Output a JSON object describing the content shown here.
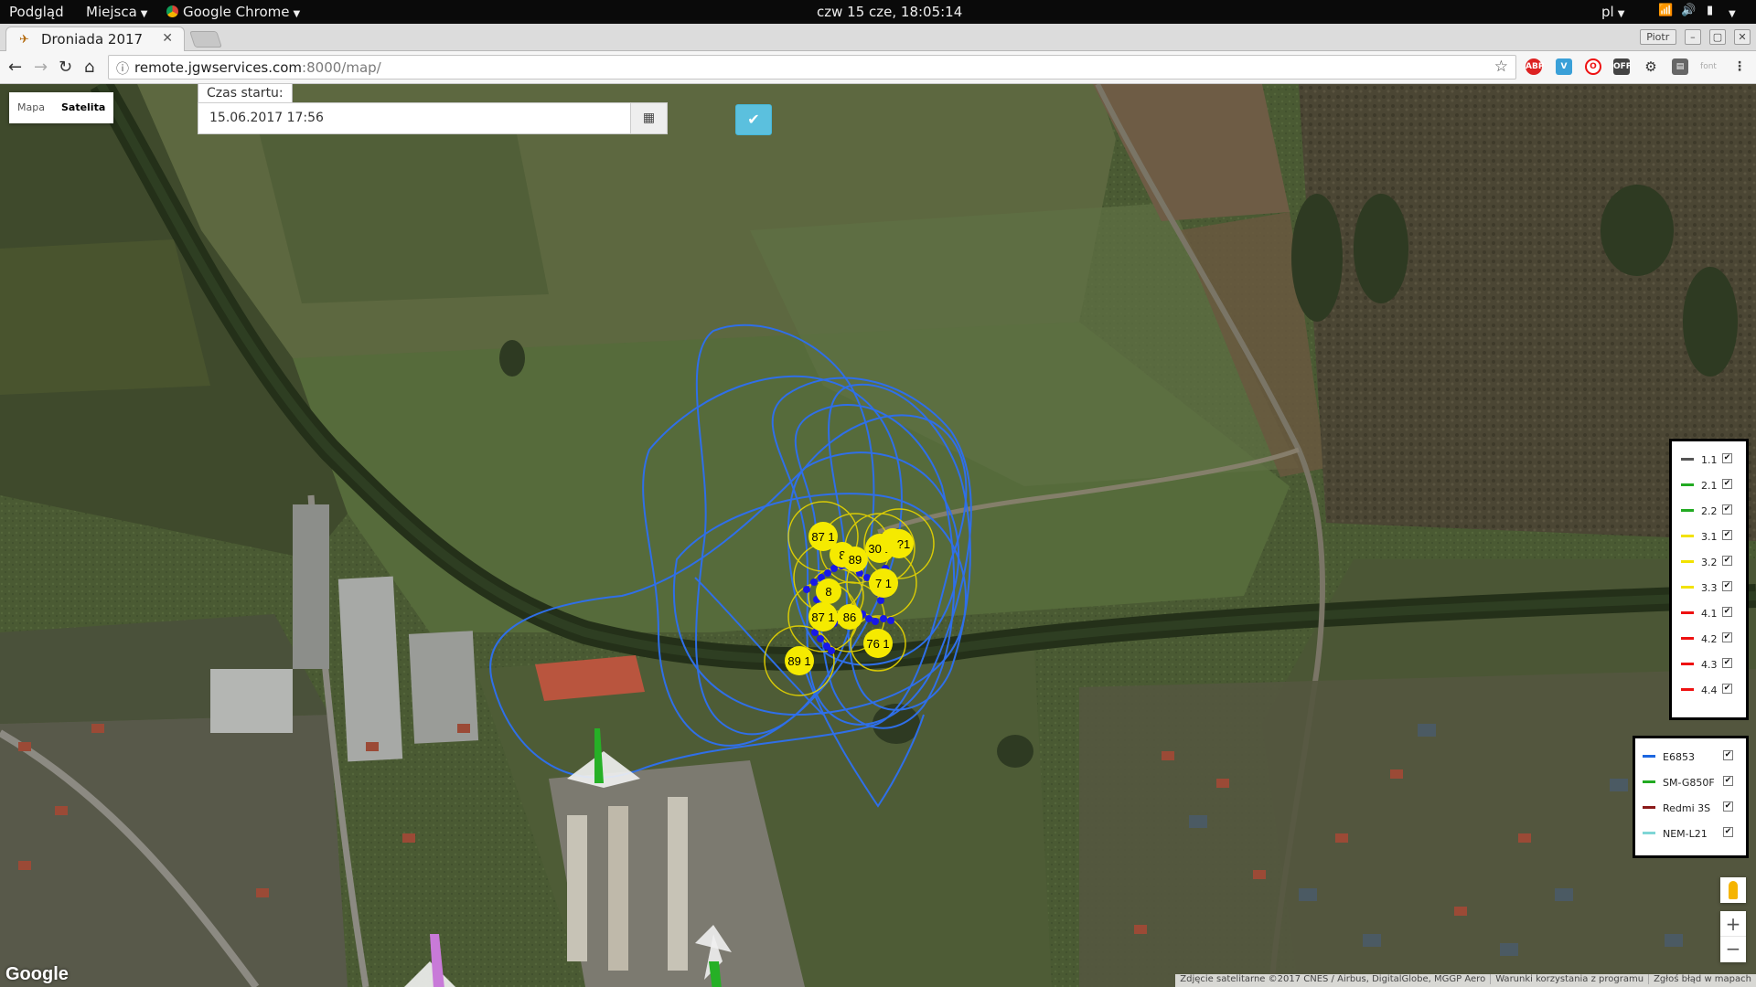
{
  "topbar": {
    "activities": "Podgląd",
    "places": "Miejsca",
    "app": "Google Chrome",
    "clock": "czw 15 cze, 18:05:14",
    "lang": "pl"
  },
  "browser": {
    "tab_title": "Droniada 2017",
    "url_host": "remote.jgwservices.com",
    "url_path": ":8000/map/",
    "profile": "Piotr"
  },
  "map": {
    "type_buttons": [
      "Mapa",
      "Satelita"
    ],
    "active_type": "Satelita",
    "start_label": "Czas startu:",
    "start_value": "15.06.2017 17:56",
    "markers": [
      {
        "label": "87 1"
      },
      {
        "label": "8"
      },
      {
        "label": "89"
      },
      {
        "label": "30 1"
      },
      {
        "label": "3?"
      },
      {
        "label": "?1"
      },
      {
        "label": "87 1"
      },
      {
        "label": "86"
      },
      {
        "label": "76 1"
      },
      {
        "label": "89 1"
      },
      {
        "label": "7 1"
      },
      {
        "label": "8"
      }
    ],
    "drones": {
      "items": [
        {
          "label": "1.1",
          "color": "#555555",
          "checked": true
        },
        {
          "label": "2.1",
          "color": "#22aa22",
          "checked": true
        },
        {
          "label": "2.2",
          "color": "#22aa22",
          "checked": true
        },
        {
          "label": "3.1",
          "color": "#f2e200",
          "checked": true
        },
        {
          "label": "3.2",
          "color": "#f2e200",
          "checked": true
        },
        {
          "label": "3.3",
          "color": "#f2e200",
          "checked": true
        },
        {
          "label": "4.1",
          "color": "#ee1111",
          "checked": true
        },
        {
          "label": "4.2",
          "color": "#ee1111",
          "checked": true
        },
        {
          "label": "4.3",
          "color": "#ee1111",
          "checked": true
        },
        {
          "label": "4.4",
          "color": "#ee1111",
          "checked": true
        }
      ]
    },
    "devices": {
      "items": [
        {
          "label": "E6853",
          "color": "#1c66e0",
          "checked": true
        },
        {
          "label": "SM-G850F",
          "color": "#22aa22",
          "checked": true
        },
        {
          "label": "Redmi 3S",
          "color": "#8b1a1a",
          "checked": true
        },
        {
          "label": "NEM-L21",
          "color": "#7fd6d6",
          "checked": true
        }
      ]
    },
    "google_logo": "Google",
    "attribution": [
      "Zdjęcie satelitarne ©2017 CNES / Airbus, DigitalGlobe, MGGP Aero",
      "Warunki korzystania z programu",
      "Zgłoś błąd w mapach"
    ],
    "zoom_in": "+",
    "zoom_out": "−"
  }
}
